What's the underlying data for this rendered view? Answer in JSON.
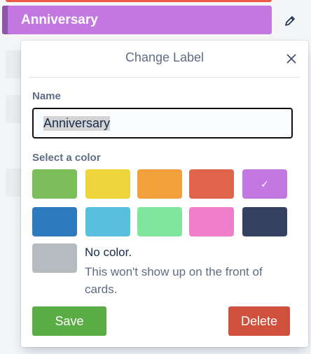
{
  "background": {
    "label_row": {
      "text": "Anniversary",
      "color": "#c377e0"
    },
    "strip_color": "#eb5a46",
    "edit_icon": "pencil-icon"
  },
  "popover": {
    "title": "Change Label",
    "close_icon": "close-icon",
    "name_label": "Name",
    "name_value": "Anniversary",
    "color_label": "Select a color",
    "colors": [
      {
        "name": "green",
        "hex": "#7bbe5a",
        "selected": false
      },
      {
        "name": "yellow",
        "hex": "#efd53c",
        "selected": false
      },
      {
        "name": "orange",
        "hex": "#f2a03b",
        "selected": false
      },
      {
        "name": "red",
        "hex": "#e0644c",
        "selected": false
      },
      {
        "name": "purple",
        "hex": "#c377e0",
        "selected": true,
        "check": "✓"
      },
      {
        "name": "blue",
        "hex": "#2f79bf",
        "selected": false
      },
      {
        "name": "sky",
        "hex": "#57c0de",
        "selected": false
      },
      {
        "name": "lime",
        "hex": "#80e59d",
        "selected": false
      },
      {
        "name": "pink",
        "hex": "#f07fcb",
        "selected": false
      },
      {
        "name": "black",
        "hex": "#344260",
        "selected": false
      }
    ],
    "no_color": {
      "swatch_hex": "#b6bbbf",
      "title": "No color.",
      "description": "This won't show up on the front of cards."
    },
    "save_label": "Save",
    "delete_label": "Delete"
  }
}
